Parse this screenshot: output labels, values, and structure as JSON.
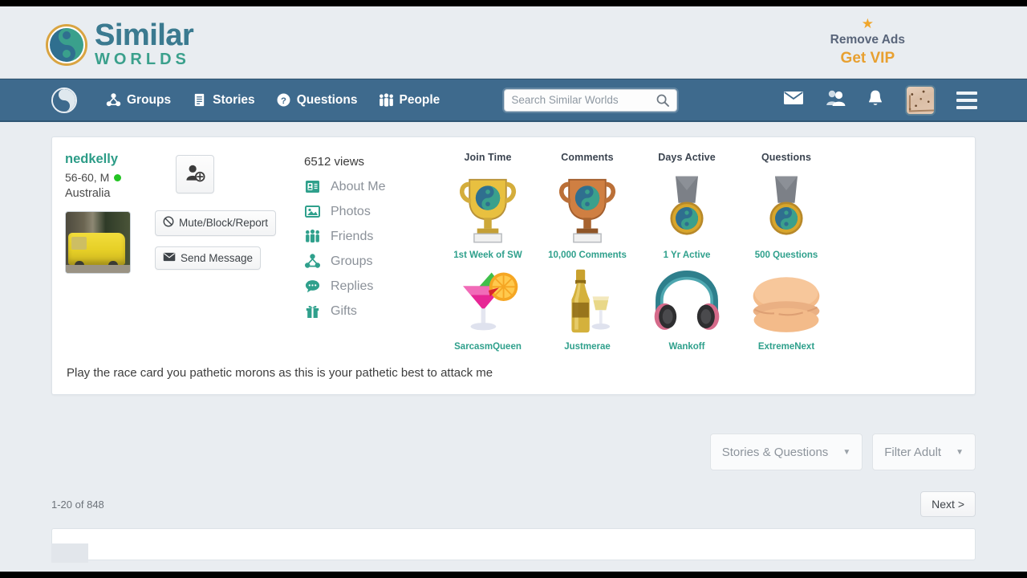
{
  "header": {
    "brand_primary": "Similar",
    "brand_secondary": "WORLDS",
    "vip_star": "★",
    "vip_remove_label": "Remove Ads",
    "vip_get_label": "Get VIP"
  },
  "nav": {
    "logo_icon": "yin-yang-icon",
    "items": [
      {
        "label": "Groups",
        "icon": "groups-icon"
      },
      {
        "label": "Stories",
        "icon": "stories-icon"
      },
      {
        "label": "Questions",
        "icon": "question-mark-icon"
      },
      {
        "label": "People",
        "icon": "people-icon"
      }
    ],
    "search": {
      "placeholder": "Search Similar Worlds",
      "value": "",
      "icon": "search-icon"
    },
    "right_icons": [
      {
        "name": "mail-icon"
      },
      {
        "name": "friends-icon"
      },
      {
        "name": "bell-icon"
      },
      {
        "name": "user-avatar"
      },
      {
        "name": "hamburger-menu-icon"
      }
    ]
  },
  "profile": {
    "username": "nedkelly",
    "age_gender": "56-60, M",
    "online": true,
    "country": "Australia",
    "photo_alt": "yellow-van-photo",
    "views": "6512 views",
    "add_friend_icon": "add-friend-icon",
    "mute_block_label": "Mute/Block/Report",
    "mute_block_icon": "ban-icon",
    "send_message_label": "Send Message",
    "send_message_icon": "envelope-icon",
    "links": [
      {
        "label": "About Me",
        "icon": "id-card-icon"
      },
      {
        "label": "Photos",
        "icon": "photo-icon"
      },
      {
        "label": "Friends",
        "icon": "friends-group-icon"
      },
      {
        "label": "Groups",
        "icon": "groups-icon"
      },
      {
        "label": "Replies",
        "icon": "comment-icon"
      },
      {
        "label": "Gifts",
        "icon": "gift-icon"
      }
    ],
    "status": "Play the race card you pathetic morons as this is your pathetic best to attack me"
  },
  "badges": [
    {
      "title": "Join Time",
      "subtitle": "1st Week of SW",
      "art": "gold-trophy",
      "color": "#e8b93a"
    },
    {
      "title": "Comments",
      "subtitle": "10,000 Comments",
      "art": "bronze-trophy",
      "color": "#c9763b"
    },
    {
      "title": "Days Active",
      "subtitle": "1 Yr Active",
      "art": "gray-medal",
      "color": "#7c8087"
    },
    {
      "title": "Questions",
      "subtitle": "500 Questions",
      "art": "gray-medal",
      "color": "#7c8087"
    }
  ],
  "gifts": [
    {
      "from": "SarcasmQueen",
      "art": "cocktail-gift"
    },
    {
      "from": "Justmerae",
      "art": "champagne-gift"
    },
    {
      "from": "Wankoff",
      "art": "headphones-gift"
    },
    {
      "from": "ExtremeNext",
      "art": "macaron-gift"
    }
  ],
  "filters": {
    "content_type": {
      "value": "Stories & Questions",
      "caret": "▼"
    },
    "adult_filter": {
      "value": "Filter Adult",
      "caret": "▼"
    }
  },
  "pagination": {
    "range_label": "1-20 of 848",
    "next_label": "Next >"
  },
  "colors": {
    "nav_bar": "#3e6a8d",
    "page_bg": "#e9edf1",
    "teal": "#2fa08c",
    "vip_orange": "#e8a030",
    "online_green": "#23c423"
  }
}
